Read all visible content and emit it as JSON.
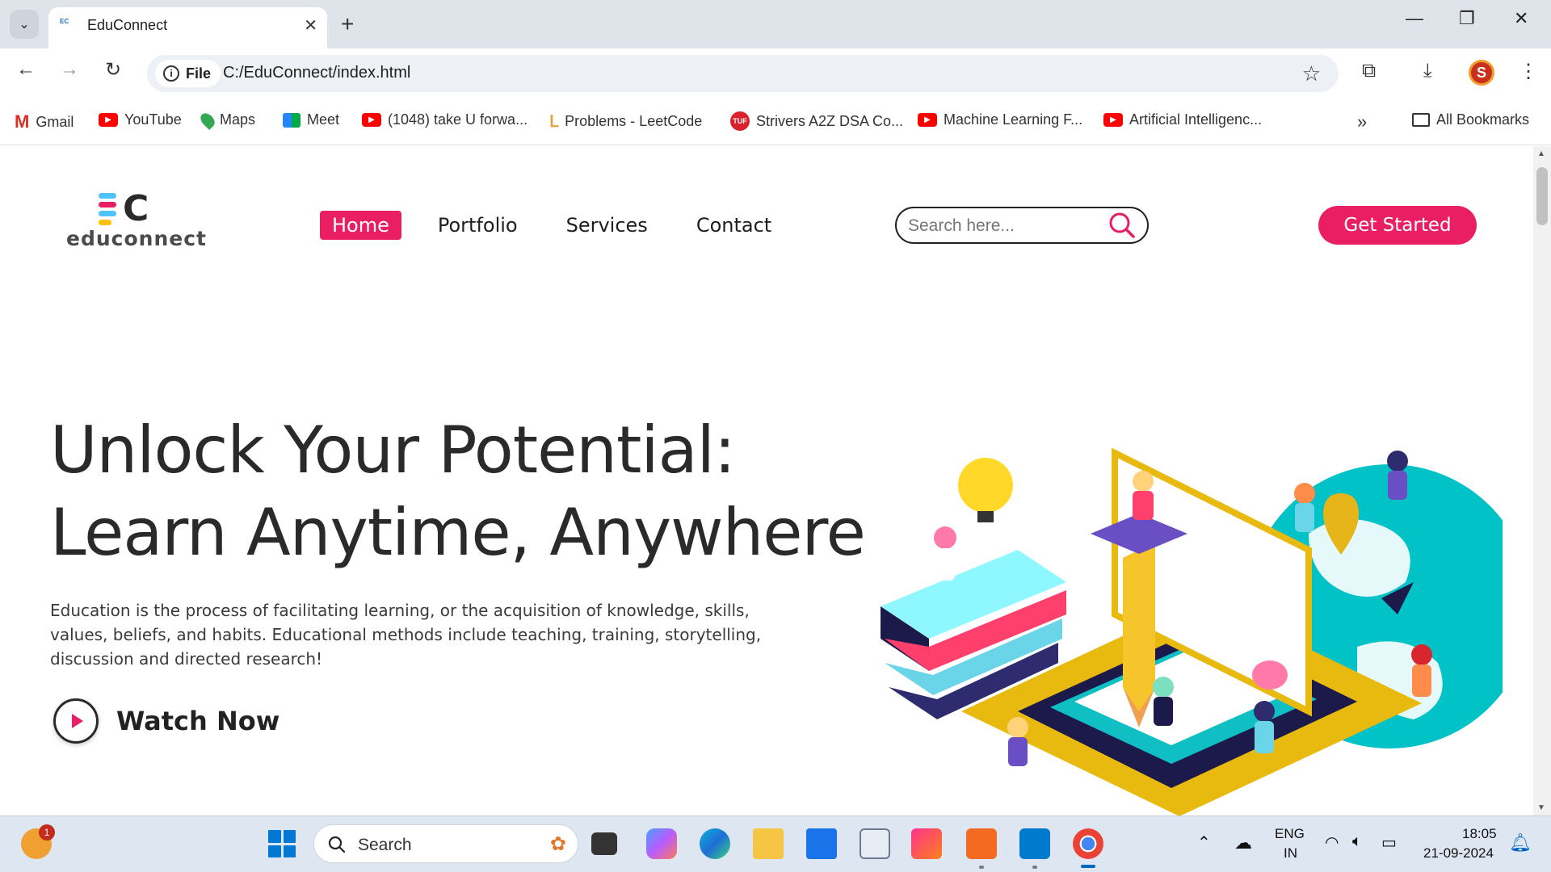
{
  "browser": {
    "tab_title": "EduConnect",
    "favicon_text": "EC",
    "chip_label": "File",
    "url": "C:/EduConnect/index.html",
    "bookmarks": [
      {
        "label": "Gmail",
        "icon": "gmail-icon"
      },
      {
        "label": "YouTube",
        "icon": "youtube-icon"
      },
      {
        "label": "Maps",
        "icon": "maps-icon"
      },
      {
        "label": "Meet",
        "icon": "meet-icon"
      },
      {
        "label": "(1048) take U forwa...",
        "icon": "youtube-icon"
      },
      {
        "label": "Problems - LeetCode",
        "icon": "leetcode-icon"
      },
      {
        "label": "Strivers A2Z DSA Co...",
        "icon": "tuf-icon"
      },
      {
        "label": "Machine Learning F...",
        "icon": "youtube-icon"
      },
      {
        "label": "Artificial Intelligenc...",
        "icon": "youtube-icon"
      }
    ],
    "all_bookmarks_label": "All Bookmarks",
    "tuf_text": "TUF",
    "profile_initial": "S"
  },
  "site": {
    "logo_text": "educonnect",
    "logo_mark": "C",
    "nav": [
      "Home",
      "Portfolio",
      "Services",
      "Contact"
    ],
    "search_placeholder": "Search here...",
    "cta_label": "Get Started",
    "hero_line1": "Unlock Your Potential:",
    "hero_line2": "Learn Anytime, Anywhere",
    "hero_text": "Education is the process of facilitating learning, or the acquisition of knowledge, skills, values, beliefs, and habits. Educational methods include teaching, training, storytelling, discussion and directed research!",
    "watch_label": "Watch Now"
  },
  "taskbar": {
    "search_label": "Search",
    "notification_count": "1",
    "lang_line1": "ENG",
    "lang_line2": "IN",
    "time": "18:05",
    "date": "21-09-2024"
  },
  "colors": {
    "accent": "#e91e63",
    "logo_bars": [
      "#4fc3f7",
      "#e91e63",
      "#ffc107"
    ],
    "logo_c": "#2a2a2a"
  }
}
